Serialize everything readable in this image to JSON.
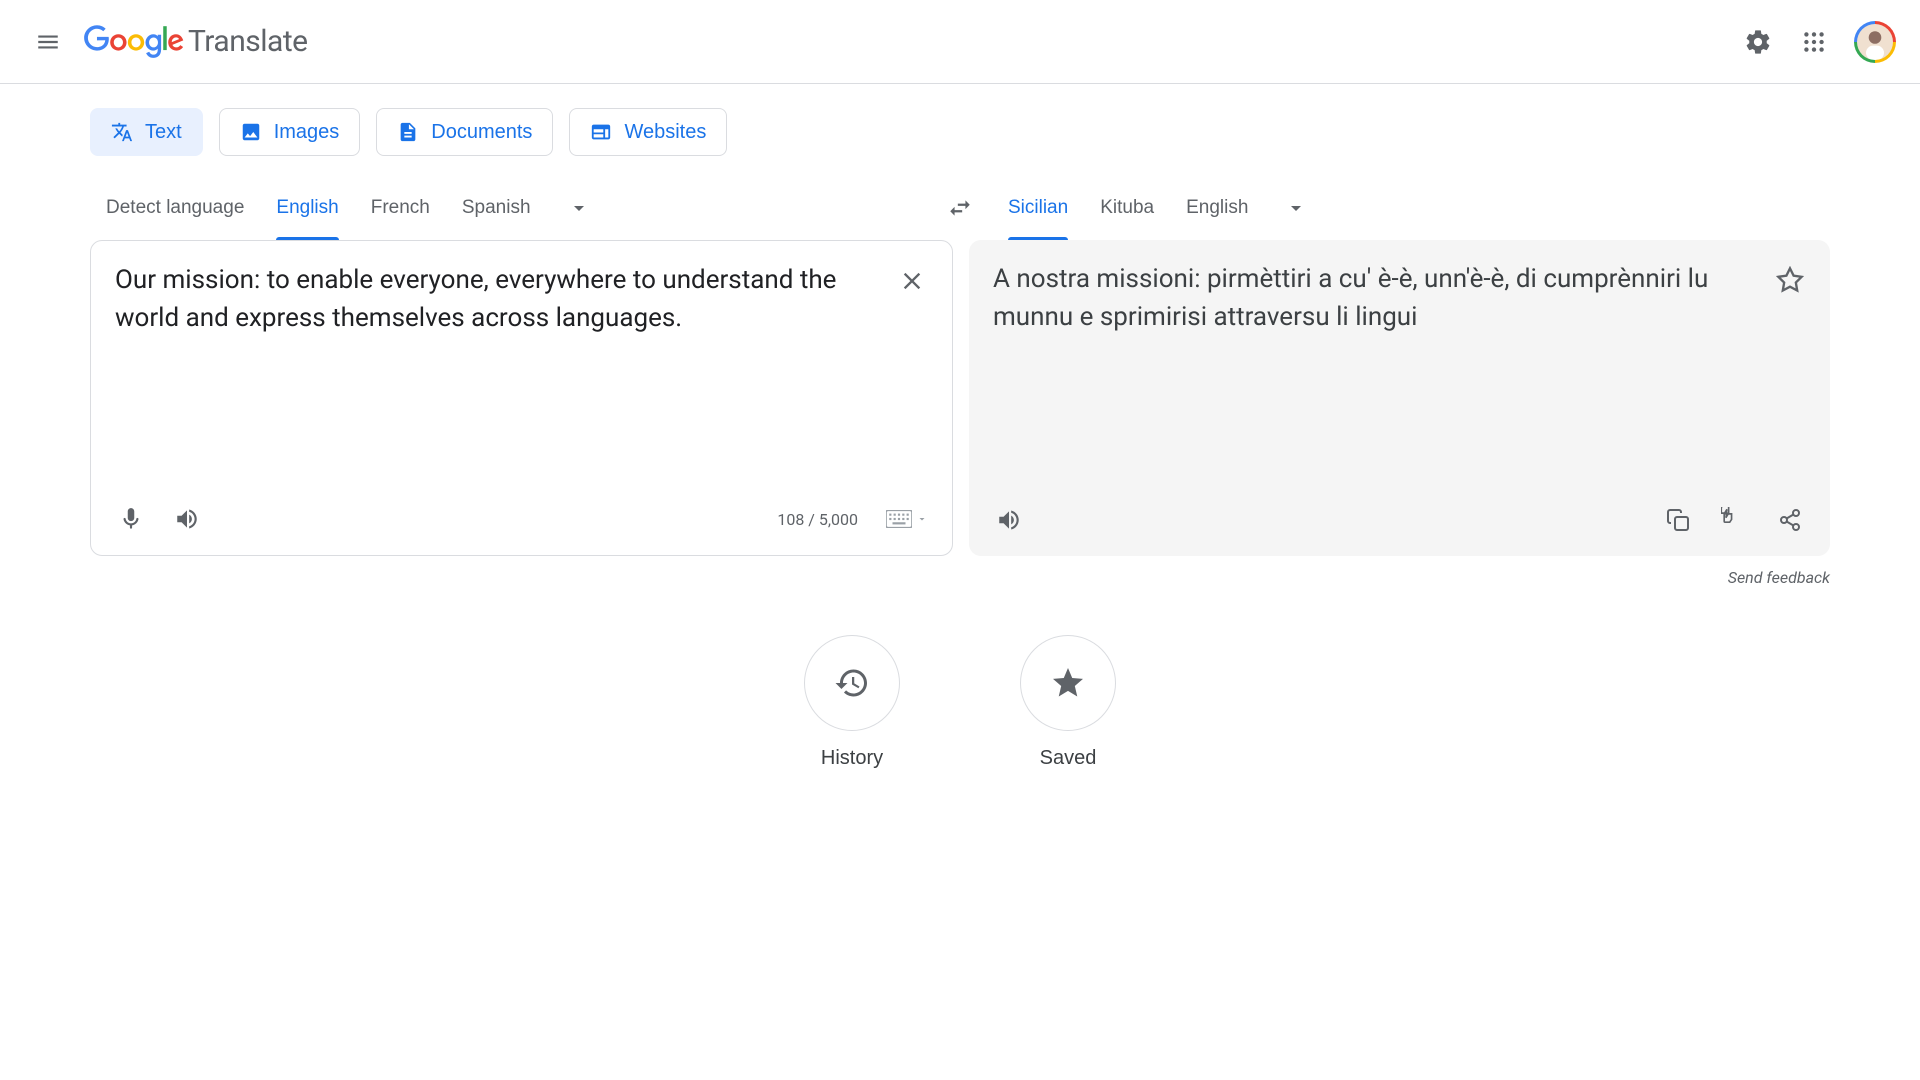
{
  "header": {
    "product": "Translate"
  },
  "modes": {
    "text": "Text",
    "images": "Images",
    "documents": "Documents",
    "websites": "Websites"
  },
  "source_langs": {
    "detect": "Detect language",
    "l1": "English",
    "l2": "French",
    "l3": "Spanish"
  },
  "target_langs": {
    "l1": "Sicilian",
    "l2": "Kituba",
    "l3": "English"
  },
  "source_text": "Our mission: to enable everyone, everywhere to understand the world and express themselves across languages.",
  "target_text": "A nostra missioni: pirmèttiri a cu' è-è, unn'è-è, di cumprènniri lu munnu e sprimirisi attraversu li lingui",
  "char_count": "108 / 5,000",
  "feedback": "Send feedback",
  "bottom": {
    "history": "History",
    "saved": "Saved"
  }
}
